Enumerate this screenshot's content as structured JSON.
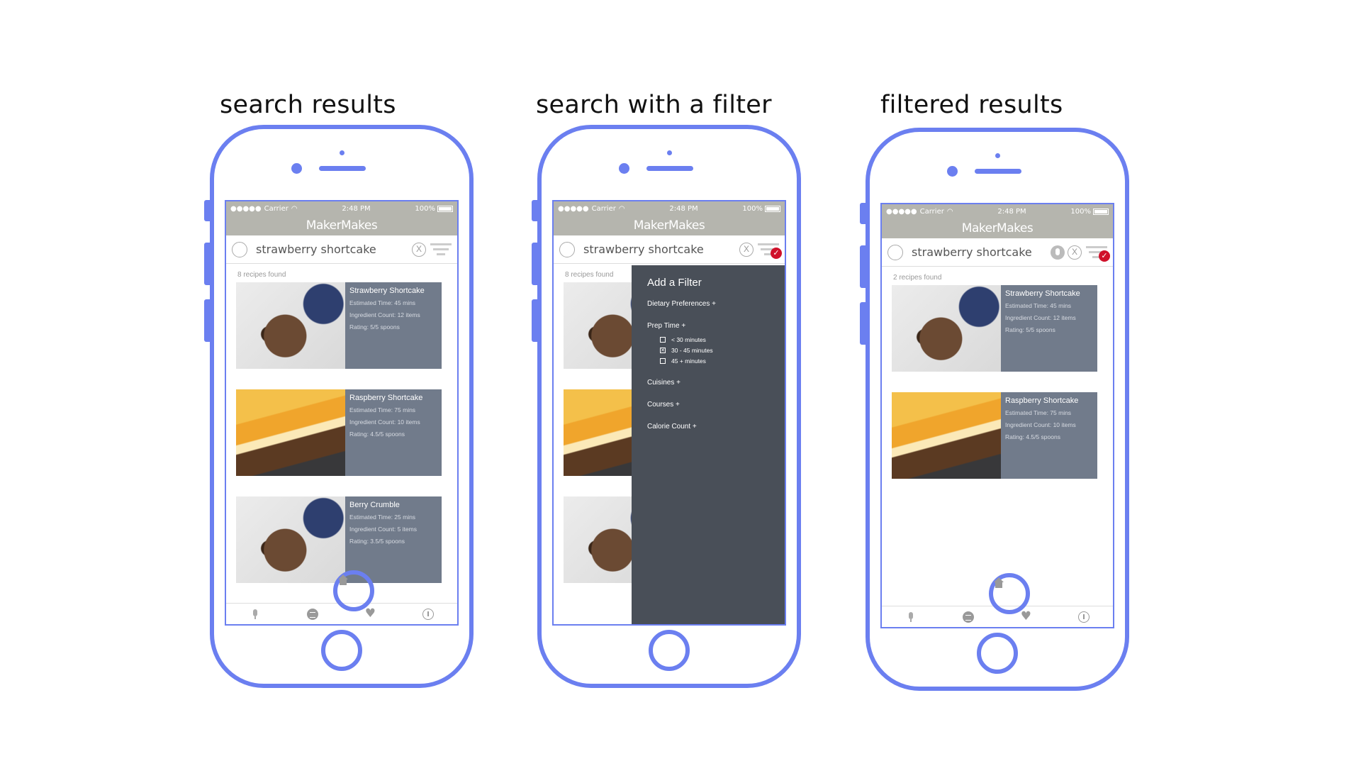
{
  "panels": [
    {
      "title": "search results"
    },
    {
      "title": "search with a filter"
    },
    {
      "title": "filtered results"
    }
  ],
  "status": {
    "carrier": "Carrier",
    "time": "2:48 PM",
    "battery": "100%"
  },
  "app": {
    "name": "MakerMakes"
  },
  "search": {
    "query": "strawberry shortcake",
    "clear_label": "X"
  },
  "screen1": {
    "found": "8 recipes found",
    "recipes": [
      {
        "name": "Strawberry Shortcake",
        "time": "Estimated Time:  45 mins",
        "ingredients": "Ingredient Count:  12 items",
        "rating": "Rating: 5/5 spoons",
        "photo": "granola"
      },
      {
        "name": "Raspberry Shortcake",
        "time": "Estimated Time:  75 mins",
        "ingredients": "Ingredient Count:  10 items",
        "rating": "Rating: 4.5/5 spoons",
        "photo": "tart"
      },
      {
        "name": "Berry Crumble",
        "time": "Estimated Time:  25 mins",
        "ingredients": "Ingredient Count: 5 items",
        "rating": "Rating: 3.5/5 spoons",
        "photo": "granola"
      }
    ]
  },
  "screen2": {
    "found": "8 recipes found",
    "filter": {
      "title": "Add a Filter",
      "dietary": "Dietary Preferences +",
      "prep": "Prep Time +",
      "prep_options": [
        {
          "label": "< 30 minutes",
          "checked": false
        },
        {
          "label": "30 - 45 minutes",
          "checked": true
        },
        {
          "label": "45 + minutes",
          "checked": false
        }
      ],
      "cuisines": "Cuisines +",
      "courses": "Courses +",
      "calorie": "Calorie Count +"
    }
  },
  "screen3": {
    "found": "2 recipes found",
    "recipes": [
      {
        "name": "Strawberry Shortcake",
        "time": "Estimated Time:  45 mins",
        "ingredients": "Ingredient Count:  12 items",
        "rating": "Rating: 5/5 spoons",
        "photo": "granola"
      },
      {
        "name": "Raspberry Shortcake",
        "time": "Estimated Time:  75 mins",
        "ingredients": "Ingredient Count:  10 items",
        "rating": "Rating: 4.5/5 spoons",
        "photo": "tart"
      }
    ]
  },
  "colors": {
    "phone_outline": "#6b7ff0",
    "appbar": "#b5b5ae",
    "card_info": "#717b8b",
    "filter_panel": "#494f58",
    "filter_active": "#d0112b"
  },
  "icons": [
    "search-icon",
    "clear-icon",
    "filter-icon",
    "mic-icon",
    "list-icon",
    "home-icon",
    "heart-icon",
    "info-icon",
    "checkmark-icon",
    "wifi-icon",
    "battery-icon"
  ]
}
